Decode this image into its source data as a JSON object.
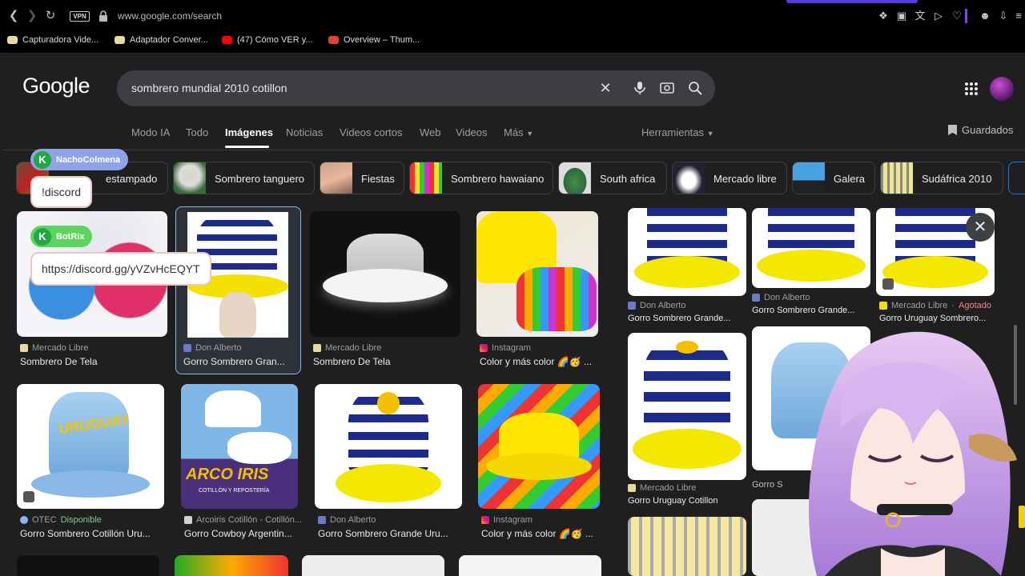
{
  "browser": {
    "url": "www.google.com/search",
    "vpn_label": "VPN",
    "bookmarks": [
      {
        "label": "Capturadora Vide...",
        "color": "#e8d9a0"
      },
      {
        "label": "Adaptador Conver...",
        "color": "#e8d9a0"
      },
      {
        "label": "(47) Cómo VER y...",
        "color": "#ff0000"
      },
      {
        "label": "Overview – Thum...",
        "color": "#e04040"
      }
    ]
  },
  "google": {
    "logo": "Google",
    "query": "sombrero mundial 2010 cotillon",
    "tabs": [
      "Modo IA",
      "Todo",
      "Imágenes",
      "Noticias",
      "Videos cortos",
      "Web",
      "Videos",
      "Más"
    ],
    "active_tab": "Imágenes",
    "tools": "Herramientas",
    "saved": "Guardados",
    "chips": [
      "estampado",
      "Sombrero tanguero",
      "Fiestas",
      "Sombrero hawaiano",
      "South africa",
      "Mercado libre",
      "Galera",
      "Sudáfrica 2010"
    ]
  },
  "results": [
    {
      "source": "Mercado Libre",
      "title": "Sombrero De Tela"
    },
    {
      "source": "Don Alberto",
      "title": "Gorro Sombrero Gran..."
    },
    {
      "source": "Mercado Libre",
      "title": "Sombrero De Tela"
    },
    {
      "source": "Instagram",
      "title": "Color y más color 🌈🥳 ..."
    },
    {
      "source": "OTEC",
      "status": "Disponible",
      "title": "Gorro Sombrero Cotillón Uru..."
    },
    {
      "source": "Arcoiris Cotillón - Cotillón...",
      "title": "Gorro Cowboy Argentin..."
    },
    {
      "source": "Don Alberto",
      "title": "Gorro Sombrero Grande Uru..."
    },
    {
      "source": "Instagram",
      "title": "Color y más color 🌈🥳 ..."
    }
  ],
  "side_results": [
    {
      "source": "Don Alberto",
      "title": "Gorro Sombrero Grande..."
    },
    {
      "source": "Don Alberto",
      "title": "Gorro Sombrero Grande..."
    },
    {
      "source": "Mercado Libre",
      "status": "Agotado",
      "title": "Gorro Uruguay Sombrero..."
    },
    {
      "source": "Mercado Libre",
      "title": "Gorro Uruguay Cotillon"
    },
    {
      "source": "Gorro S"
    }
  ],
  "thumb_text": {
    "uruguay": "URUGUAY",
    "arcoiris": "ARCO IRIS",
    "arcoiris_sub": "COTILLÓN Y REPOSTERÍA"
  },
  "overlay": {
    "user1": "NachoColmena",
    "cmd1": "!discord",
    "user2": "BotRix",
    "link": "https://discord.gg/yVZvHcEQYT"
  }
}
